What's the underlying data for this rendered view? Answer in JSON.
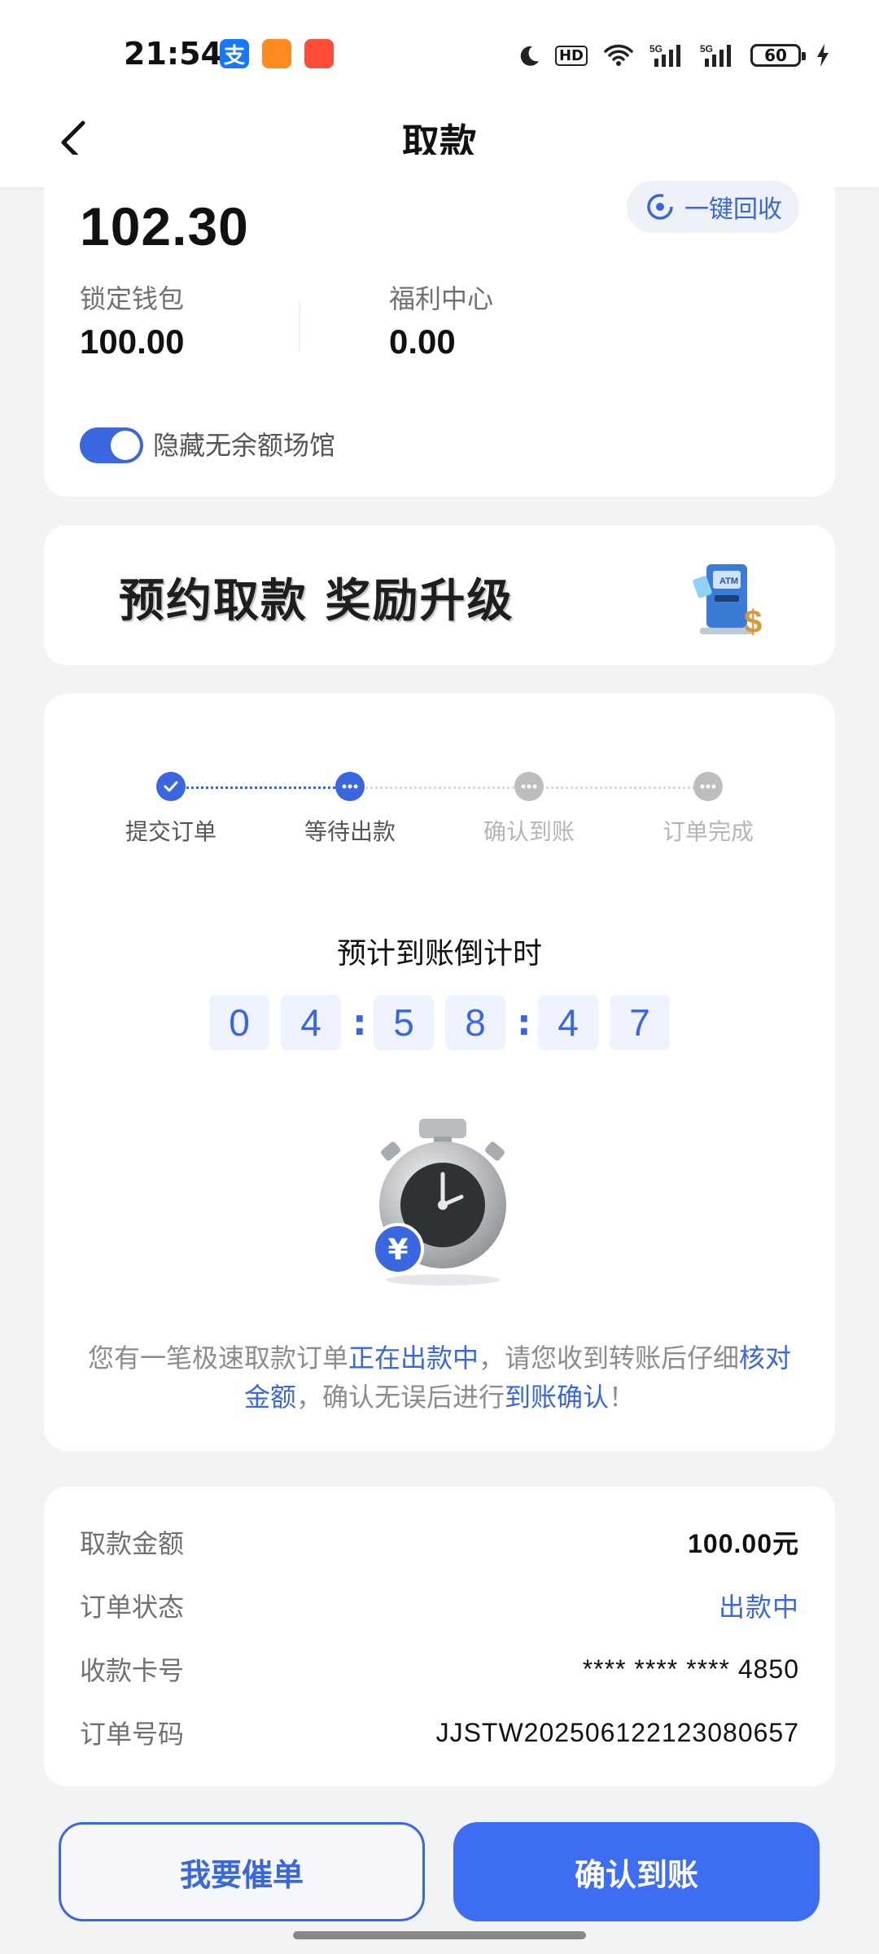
{
  "status_bar": {
    "time": "21:54",
    "battery": "60"
  },
  "header": {
    "title": "取款"
  },
  "wallet": {
    "balance": "102.30",
    "recycle_label": "一键回收",
    "locked_wallet_label": "锁定钱包",
    "locked_wallet_value": "100.00",
    "welfare_label": "福利中心",
    "welfare_value": "0.00",
    "hide_empty_label": "隐藏无余额场馆",
    "hide_empty_enabled": true
  },
  "banner": {
    "text": "预约取款 奖励升级"
  },
  "progress": {
    "steps": [
      {
        "label": "提交订单",
        "state": "done"
      },
      {
        "label": "等待出款",
        "state": "current"
      },
      {
        "label": "确认到账",
        "state": "pending"
      },
      {
        "label": "订单完成",
        "state": "pending"
      }
    ],
    "countdown_title": "预计到账倒计时",
    "countdown_digits": [
      "0",
      "4",
      "5",
      "8",
      "4",
      "7"
    ],
    "message": {
      "p1": "您有一笔极速取款订单",
      "hl1": "正在出款中",
      "p2": "，请您收到转账后仔细",
      "hl2": "核对金额",
      "p3": "，确认无误后进行",
      "hl3": "到账确认",
      "p4": "！"
    }
  },
  "details": {
    "amount_label": "取款金额",
    "amount_value": "100.00元",
    "status_label": "订单状态",
    "status_value": "出款中",
    "card_label": "收款卡号",
    "card_value": "**** **** **** 4850",
    "order_label": "订单号码",
    "order_value": "JJSTW20250612212308065​7"
  },
  "buttons": {
    "urge": "我要催单",
    "confirm": "确认到账"
  },
  "colors": {
    "accent": "#3a67e0",
    "primary_button": "#3d6df3",
    "background": "#f2f3f5"
  }
}
